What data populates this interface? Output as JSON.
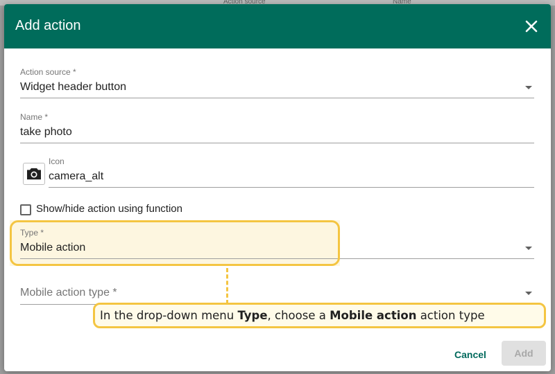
{
  "background": {
    "columns": [
      "Action source",
      "Name"
    ]
  },
  "dialog": {
    "title": "Add action",
    "close_icon": "close-icon"
  },
  "form": {
    "action_source": {
      "label": "Action source *",
      "value": "Widget header button"
    },
    "name": {
      "label": "Name *",
      "value": "take photo"
    },
    "icon": {
      "label": "Icon",
      "value": "camera_alt",
      "icon": "camera-icon"
    },
    "show_hide": {
      "label": "Show/hide action using function",
      "checked": false
    },
    "type": {
      "label": "Type *",
      "value": "Mobile action"
    },
    "mobile_action_type": {
      "placeholder": "Mobile action type *"
    }
  },
  "callout": {
    "part1": "In the drop-down menu ",
    "bold1": "Type",
    "part2": ", choose a ",
    "bold2": "Mobile action",
    "part3": " action type"
  },
  "buttons": {
    "cancel": "Cancel",
    "add": "Add"
  },
  "colors": {
    "header": "#006c5b",
    "accent": "#00695c",
    "highlight": "#f4c542"
  }
}
